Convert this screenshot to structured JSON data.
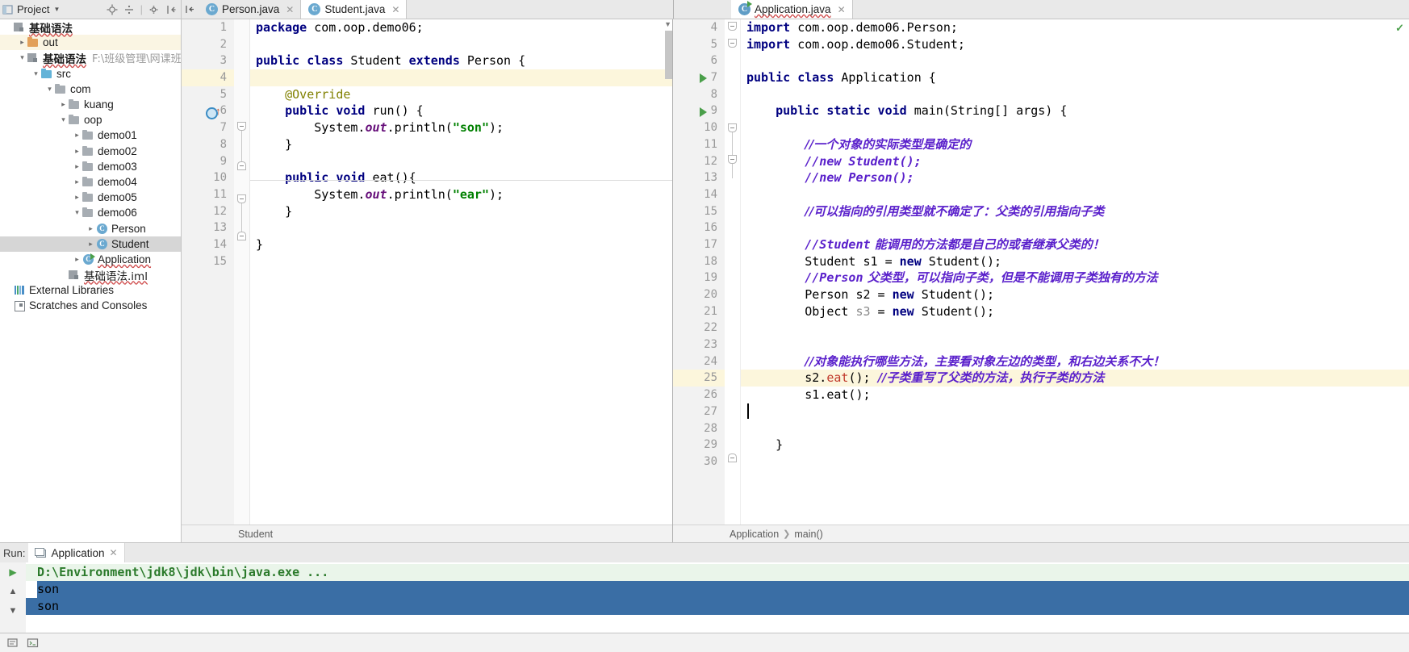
{
  "project_panel": {
    "title": "Project",
    "icons": [
      "project-view-icon",
      "caret-down-icon",
      "locate-icon",
      "collapse-all-icon",
      "settings-gear-icon",
      "hide-panel-icon"
    ],
    "tree": [
      {
        "indent": 0,
        "arrow": "none",
        "icon": "module-icon",
        "label": "基础语法",
        "bold": true,
        "path": "",
        "state": "normal"
      },
      {
        "indent": 1,
        "arrow": "closed",
        "icon": "folder-orange",
        "label": "out",
        "bold": false,
        "path": "",
        "state": "highlight"
      },
      {
        "indent": 1,
        "arrow": "open",
        "icon": "module-icon",
        "label": "基础语法",
        "bold": true,
        "path": "F:\\班级管理\\网课班\\代码\\Ja",
        "state": "normal"
      },
      {
        "indent": 2,
        "arrow": "open",
        "icon": "folder-blue",
        "label": "src",
        "bold": false,
        "path": "",
        "state": "normal"
      },
      {
        "indent": 3,
        "arrow": "open",
        "icon": "folder-grey",
        "label": "com",
        "bold": false,
        "path": "",
        "state": "normal"
      },
      {
        "indent": 4,
        "arrow": "closed",
        "icon": "folder-grey",
        "label": "kuang",
        "bold": false,
        "path": "",
        "state": "normal"
      },
      {
        "indent": 4,
        "arrow": "open",
        "icon": "folder-grey",
        "label": "oop",
        "bold": false,
        "path": "",
        "state": "normal"
      },
      {
        "indent": 5,
        "arrow": "closed",
        "icon": "folder-grey",
        "label": "demo01",
        "bold": false,
        "path": "",
        "state": "normal"
      },
      {
        "indent": 5,
        "arrow": "closed",
        "icon": "folder-grey",
        "label": "demo02",
        "bold": false,
        "path": "",
        "state": "normal"
      },
      {
        "indent": 5,
        "arrow": "closed",
        "icon": "folder-grey",
        "label": "demo03",
        "bold": false,
        "path": "",
        "state": "normal"
      },
      {
        "indent": 5,
        "arrow": "closed",
        "icon": "folder-grey",
        "label": "demo04",
        "bold": false,
        "path": "",
        "state": "normal"
      },
      {
        "indent": 5,
        "arrow": "closed",
        "icon": "folder-grey",
        "label": "demo05",
        "bold": false,
        "path": "",
        "state": "normal"
      },
      {
        "indent": 5,
        "arrow": "open",
        "icon": "folder-grey",
        "label": "demo06",
        "bold": false,
        "path": "",
        "state": "normal"
      },
      {
        "indent": 6,
        "arrow": "closed",
        "icon": "java-class-icon",
        "label": "Person",
        "bold": false,
        "path": "",
        "state": "normal"
      },
      {
        "indent": 6,
        "arrow": "closed",
        "icon": "java-class-icon",
        "label": "Student",
        "bold": false,
        "path": "",
        "state": "selected"
      },
      {
        "indent": 5,
        "arrow": "closed",
        "icon": "java-runnable-icon",
        "label": "Application",
        "bold": false,
        "path": "",
        "state": "normal"
      },
      {
        "indent": 4,
        "arrow": "none",
        "icon": "iml-file-icon",
        "label": "基础语法.iml",
        "bold": false,
        "path": "",
        "state": "normal"
      },
      {
        "indent": 0,
        "arrow": "none",
        "icon": "libraries-icon",
        "label": "External Libraries",
        "bold": false,
        "path": "",
        "state": "normal"
      },
      {
        "indent": 0,
        "arrow": "none",
        "icon": "scratches-icon",
        "label": "Scratches and Consoles",
        "bold": false,
        "path": "",
        "state": "normal"
      }
    ]
  },
  "editor_left": {
    "tabs": [
      {
        "label": "Person.java",
        "icon": "java-class-icon",
        "active": false
      },
      {
        "label": "Student.java",
        "icon": "java-class-icon",
        "active": true
      }
    ],
    "breadcrumb": [
      "Student"
    ],
    "first_line": 1,
    "highlight_line": 4,
    "lines": [
      {
        "n": 1,
        "html": "<span class=\"kw\">package</span> com.oop.demo06;"
      },
      {
        "n": 2,
        "html": ""
      },
      {
        "n": 3,
        "html": "<span class=\"kw\">public class</span> Student <span class=\"kw\">extends</span> Person {"
      },
      {
        "n": 4,
        "html": ""
      },
      {
        "n": 5,
        "html": "    <span class=\"anno\">@Override</span>"
      },
      {
        "n": 6,
        "html": "    <span class=\"kw\">public void</span> run() {"
      },
      {
        "n": 7,
        "html": "        System.<span class=\"fld\">out</span>.println(<span class=\"str\">\"son\"</span>);"
      },
      {
        "n": 8,
        "html": "    }"
      },
      {
        "n": 9,
        "html": ""
      },
      {
        "n": 10,
        "html": "    <span class=\"kw\">public void</span> eat(){"
      },
      {
        "n": 11,
        "html": "        System.<span class=\"fld\">out</span>.println(<span class=\"str\">\"ear\"</span>);"
      },
      {
        "n": 12,
        "html": "    }"
      },
      {
        "n": 13,
        "html": ""
      },
      {
        "n": 14,
        "html": "}"
      },
      {
        "n": 15,
        "html": ""
      }
    ]
  },
  "editor_right": {
    "tabs": [
      {
        "label": "Application.java",
        "icon": "java-runnable-icon",
        "active": true
      }
    ],
    "breadcrumb": [
      "Application",
      "main()"
    ],
    "highlight_line": 25,
    "lines": [
      {
        "n": 4,
        "html": "<span class=\"kw\">import</span> com.oop.demo06.Person;"
      },
      {
        "n": 5,
        "html": "<span class=\"kw\">import</span> com.oop.demo06.Student;"
      },
      {
        "n": 6,
        "html": ""
      },
      {
        "n": 7,
        "html": "<span class=\"kw\">public class</span> Application {"
      },
      {
        "n": 8,
        "html": ""
      },
      {
        "n": 9,
        "html": "    <span class=\"kw\">public static void</span> main(String[] args) {"
      },
      {
        "n": 10,
        "html": ""
      },
      {
        "n": 11,
        "html": "        <span class=\"cmt-zh\">//一个对象的实际类型是确定的</span>"
      },
      {
        "n": 12,
        "html": "        <span class=\"cmt\">//new Student();</span>"
      },
      {
        "n": 13,
        "html": "        <span class=\"cmt\">//new Person();</span>"
      },
      {
        "n": 14,
        "html": ""
      },
      {
        "n": 15,
        "html": "        <span class=\"cmt-zh\">//可以指向的引用类型就不确定了：父类的引用指向子类</span>"
      },
      {
        "n": 16,
        "html": ""
      },
      {
        "n": 17,
        "html": "        <span class=\"cmt\">//Student</span><span class=\"cmt-zh\"> 能调用的方法都是自己的或者继承父类的！</span>"
      },
      {
        "n": 18,
        "html": "        Student s1 = <span class=\"kw\">new</span> Student();"
      },
      {
        "n": 19,
        "html": "        <span class=\"cmt\">//Person</span><span class=\"cmt-zh\"> 父类型，可以指向子类，但是不能调用子类独有的方法</span>"
      },
      {
        "n": 20,
        "html": "        Person s2 = <span class=\"kw\">new</span> Student();"
      },
      {
        "n": 21,
        "html": "        Object <span class=\"dim\">s3</span> = <span class=\"kw\">new</span> Student();"
      },
      {
        "n": 22,
        "html": ""
      },
      {
        "n": 23,
        "html": ""
      },
      {
        "n": 24,
        "html": "        <span class=\"cmt-zh\">//对象能执行哪些方法，主要看对象左边的类型，和右边关系不大！</span>"
      },
      {
        "n": 25,
        "html": "        s2.<span class=\"err\">eat</span>(); <span class=\"cmt-zh\">//子类重写了父类的方法，执行子类的方法</span>"
      },
      {
        "n": 26,
        "html": "        s1.eat();"
      },
      {
        "n": 27,
        "html": ""
      },
      {
        "n": 28,
        "html": ""
      },
      {
        "n": 29,
        "html": "    }"
      },
      {
        "n": 30,
        "html": ""
      }
    ]
  },
  "run_console": {
    "label": "Run:",
    "tab": "Application",
    "tab_icon": "console-icon",
    "sidebar_icons": [
      "rerun-icon",
      "scroll-up-icon",
      "scroll-down-icon"
    ],
    "lines": [
      {
        "text": "D:\\Environment\\jdk8\\jdk\\bin\\java.exe ...",
        "type": "command"
      },
      {
        "text": "son",
        "type": "output",
        "selection": "partial"
      },
      {
        "text": "son",
        "type": "output",
        "selection": "full"
      }
    ]
  },
  "status_bar": {
    "icons": [
      "event-log-icon",
      "terminal-icon"
    ]
  },
  "colors": {
    "keyword": "#000080",
    "string": "#008000",
    "comment": "#5a20cb",
    "error": "#c0392b",
    "annotation": "#808000",
    "field": "#660e7a",
    "highlight_line": "#fcf6dc",
    "selection": "#3a6ea5",
    "selected_tree_row": "#d6d6d6"
  }
}
